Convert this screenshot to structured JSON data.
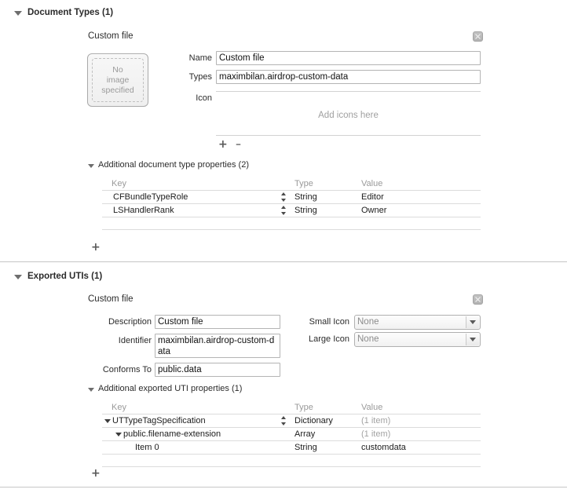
{
  "document_types": {
    "header": "Document Types (1)",
    "item_title": "Custom file",
    "image_well": {
      "line1": "No",
      "line2": "image",
      "line3": "specified"
    },
    "fields": {
      "name_label": "Name",
      "name_value": "Custom file",
      "types_label": "Types",
      "types_value": "maximbilan.airdrop-custom-data",
      "icon_label": "Icon",
      "icon_dropzone": "Add icons here"
    },
    "add_label": "+",
    "remove_label": "–",
    "close_icon": "close-icon",
    "properties": {
      "header": "Additional document type properties (2)",
      "columns": [
        "Key",
        "Type",
        "Value"
      ],
      "rows": [
        {
          "key": "CFBundleTypeRole",
          "type": "String",
          "value": "Editor",
          "indent": 0,
          "stepper": true,
          "disclosure": "none",
          "muted_value": false
        },
        {
          "key": "LSHandlerRank",
          "type": "String",
          "value": "Owner",
          "indent": 0,
          "stepper": true,
          "disclosure": "none",
          "muted_value": false
        }
      ],
      "add_label": "+"
    }
  },
  "exported_utis": {
    "header": "Exported UTIs (1)",
    "item_title": "Custom file",
    "close_icon": "close-icon",
    "fields": {
      "description_label": "Description",
      "description_value": "Custom file",
      "identifier_label": "Identifier",
      "identifier_value": "maximbilan.airdrop-custom-data",
      "conforms_label": "Conforms To",
      "conforms_value": "public.data",
      "small_icon_label": "Small Icon",
      "small_icon_value": "None",
      "large_icon_label": "Large Icon",
      "large_icon_value": "None"
    },
    "properties": {
      "header": "Additional exported UTI properties (1)",
      "columns": [
        "Key",
        "Type",
        "Value"
      ],
      "rows": [
        {
          "key": "UTTypeTagSpecification",
          "type": "Dictionary",
          "value": "(1 item)",
          "indent": 0,
          "stepper": true,
          "disclosure": "open",
          "muted_value": true
        },
        {
          "key": "public.filename-extension",
          "type": "Array",
          "value": "(1 item)",
          "indent": 1,
          "stepper": false,
          "disclosure": "open",
          "muted_value": true
        },
        {
          "key": "Item 0",
          "type": "String",
          "value": "customdata",
          "indent": 2,
          "stepper": false,
          "disclosure": "none",
          "muted_value": false
        }
      ],
      "add_label": "+"
    }
  },
  "colors": {
    "background": "#ffffff",
    "text": "#1a1a1a",
    "muted_text": "#9a9a9a",
    "line": "#d2d2d2",
    "field_border": "#b4b4b4"
  }
}
